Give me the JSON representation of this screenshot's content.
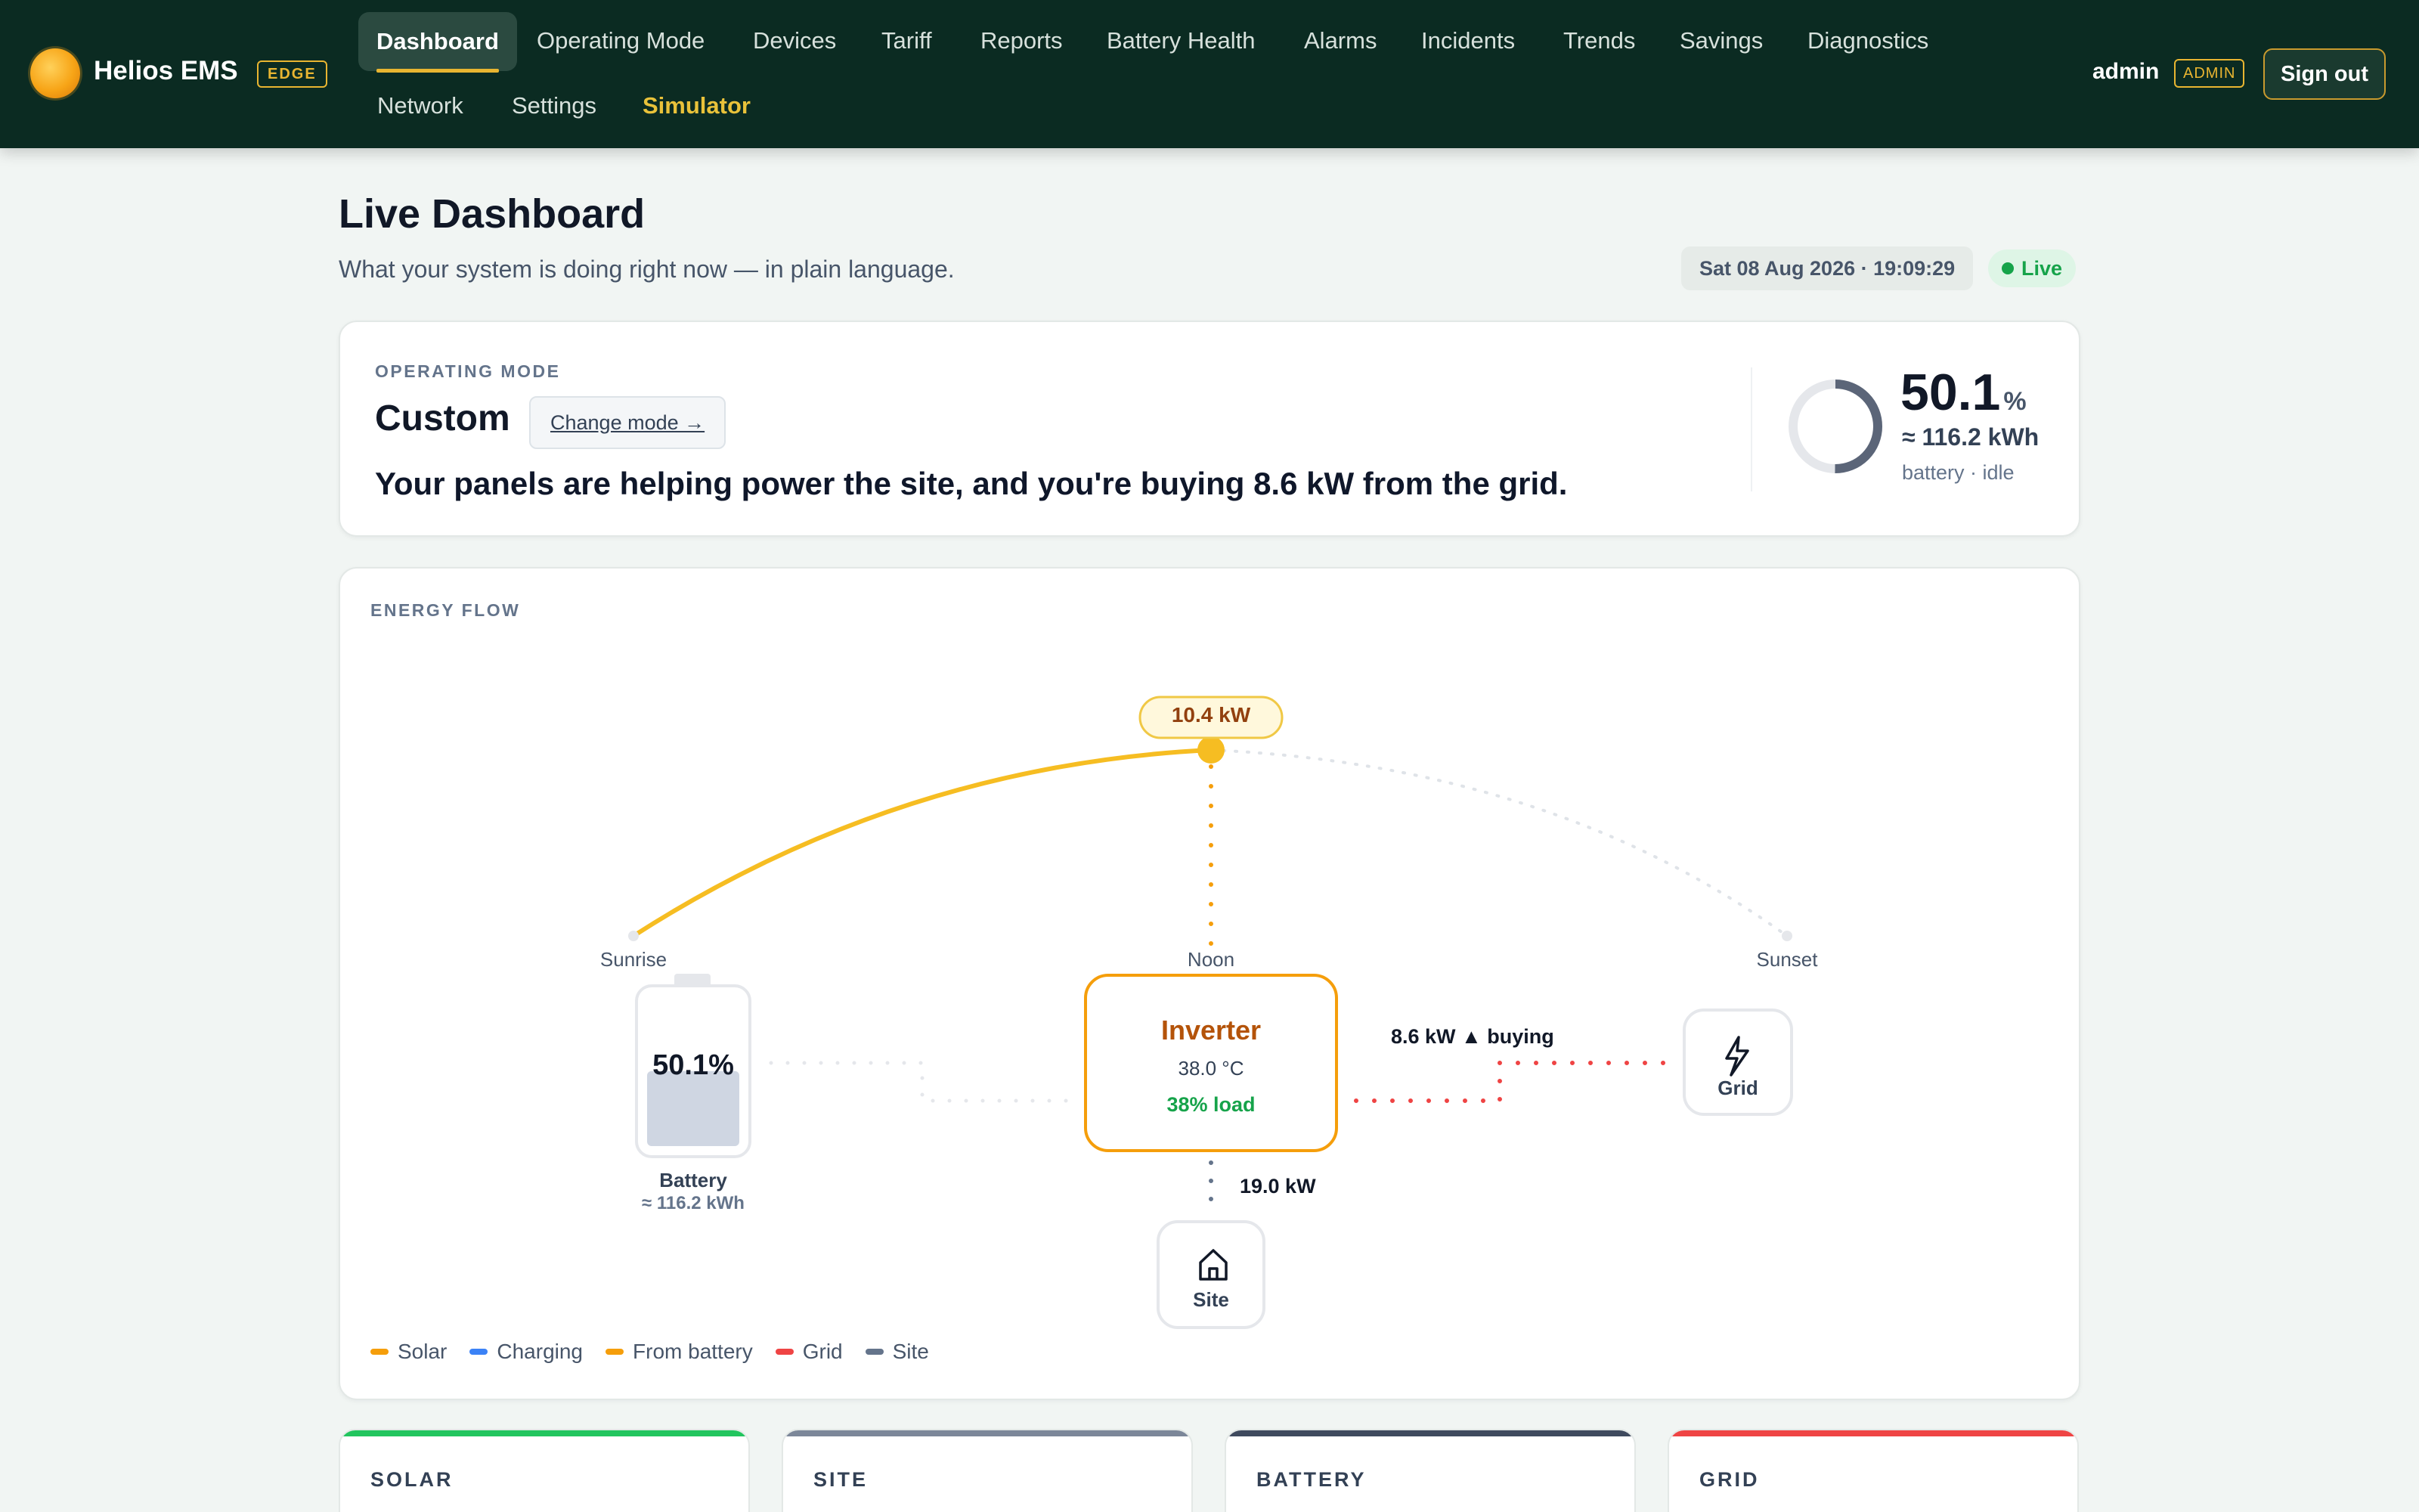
{
  "brand": {
    "name": "Helios EMS",
    "badge": "EDGE"
  },
  "nav": {
    "items": [
      "Dashboard",
      "Operating Mode",
      "Devices",
      "Tariff",
      "Reports",
      "Battery Health",
      "Alarms",
      "Incidents",
      "Trends",
      "Savings",
      "Diagnostics",
      "Network",
      "Settings",
      "Simulator"
    ],
    "active": "Dashboard"
  },
  "user": {
    "name": "admin",
    "role": "ADMIN",
    "signout_label": "Sign out"
  },
  "page": {
    "title": "Live Dashboard",
    "subtitle": "What your system is doing right now — in plain language.",
    "timestamp": "Sat 08 Aug 2026 · 19:09:29",
    "live_label": "Live"
  },
  "mode": {
    "eyebrow": "OPERATING MODE",
    "name": "Custom",
    "change_label": "Change mode →",
    "sentence": "Your panels are helping power the site, and you're buying 8.6 kW from the grid."
  },
  "battery_summary": {
    "soc": "50.1",
    "soc_unit": "%",
    "energy": "≈ 116.2 kWh",
    "state": "battery · idle",
    "soc_fraction": 0.501
  },
  "flow": {
    "eyebrow": "ENERGY FLOW",
    "solar_power": "10.4 kW",
    "sun_labels": {
      "sunrise": "Sunrise",
      "noon": "Noon",
      "sunset": "Sunset"
    },
    "battery": {
      "soc": "50.1%",
      "label": "Battery",
      "energy": "≈ 116.2 kWh",
      "fill_fraction": 0.501
    },
    "inverter": {
      "title": "Inverter",
      "temp": "38.0 °C",
      "load": "38% load"
    },
    "grid": {
      "label": "Grid",
      "flow": "8.6 kW ▲ buying"
    },
    "site": {
      "label": "Site",
      "flow": "19.0 kW"
    },
    "legend": [
      {
        "label": "Solar",
        "color": "#f59e0b"
      },
      {
        "label": "Charging",
        "color": "#3b82f6"
      },
      {
        "label": "From battery",
        "color": "#f59e0b"
      },
      {
        "label": "Grid",
        "color": "#ef4444"
      },
      {
        "label": "Site",
        "color": "#64748b"
      }
    ]
  },
  "stat_cards": [
    {
      "title": "SOLAR",
      "color": "#22c55e"
    },
    {
      "title": "SITE",
      "color": "#64748b"
    },
    {
      "title": "BATTERY",
      "color": "#334155"
    },
    {
      "title": "GRID",
      "color": "#ef4444"
    }
  ]
}
